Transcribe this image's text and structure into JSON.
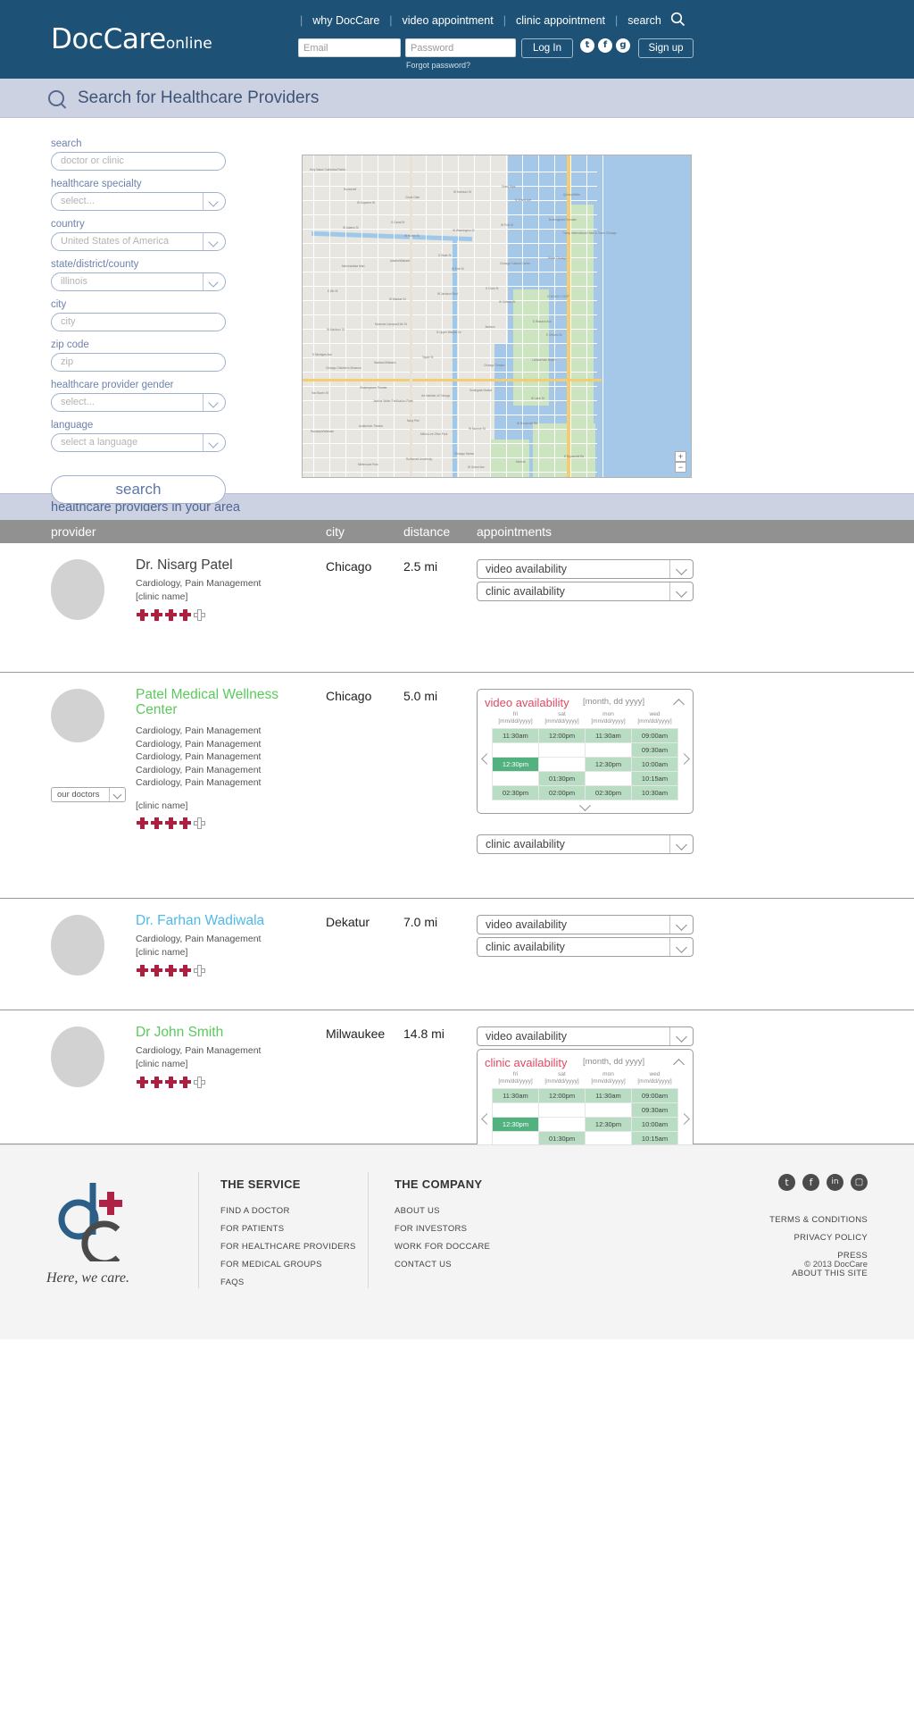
{
  "header": {
    "logo_main": "DocCare",
    "logo_sub": "online",
    "nav": [
      {
        "label": "why DocCare"
      },
      {
        "label": "video appointment"
      },
      {
        "label": "clinic appointment"
      },
      {
        "label": "search"
      }
    ],
    "search_icon": "search-icon",
    "email_placeholder": "Email",
    "password_placeholder": "Password",
    "login_label": "Log In",
    "signup_label": "Sign up",
    "forgot_label": "Forgot password?",
    "socials": [
      "t",
      "f",
      "g"
    ],
    "bg_color": "#1d5175"
  },
  "banner": {
    "title": "Search for Healthcare Providers"
  },
  "search_form": {
    "fields": [
      {
        "label": "search",
        "placeholder": "doctor or clinic",
        "type": "text",
        "name": "search-input"
      },
      {
        "label": "healthcare specialty",
        "placeholder": "select...",
        "type": "select",
        "name": "specialty-select"
      },
      {
        "label": "country",
        "placeholder": "United States of America",
        "type": "select",
        "name": "country-select"
      },
      {
        "label": "state/district/county",
        "placeholder": "illinois",
        "type": "select",
        "name": "state-select"
      },
      {
        "label": "city",
        "placeholder": "city",
        "type": "text",
        "name": "city-input"
      },
      {
        "label": "zip code",
        "placeholder": "zip",
        "type": "text",
        "name": "zip-input"
      },
      {
        "label": "healthcare provider gender",
        "placeholder": "select...",
        "type": "select",
        "name": "gender-select"
      },
      {
        "label": "language",
        "placeholder": "select a language",
        "type": "select",
        "name": "language-select"
      }
    ],
    "submit_label": "search"
  },
  "map": {
    "zoom_in": "+",
    "zoom_out": "−",
    "labels": [
      "Holy Name Cathedral Parish",
      "W Superior St",
      "W Huron St",
      "W Erie St",
      "W Ontario St",
      "E Ontario St",
      "Chicago Children's Museum",
      "Jardine Water Purification Plant",
      "Milton Lee Olive Park",
      "W Grand Ave",
      "N Grand Ave",
      "Trump International Hotel & Tower Chicago",
      "Merchandise Mart",
      "W Wacker Dr",
      "N Upper Wacker Dr",
      "Chicago Theatre",
      "W Lake St",
      "Randolph/Wabash",
      "Millennium Park",
      "Cloud Gate",
      "W Washington St",
      "Chicago Cultural Center",
      "CHICAGO LOOP",
      "W Madison St",
      "Madison/Wabash",
      "Art Institute of Chicago",
      "W Monroe St",
      "Monroe",
      "Quincy/Wells",
      "W Adams St",
      "Adams/Wabash",
      "W Jackson Blvd",
      "Jackson",
      "LaSalle/Van Buren",
      "Van Buren St",
      "Auditorium Theatre",
      "Roosevelt University",
      "W Harrison St",
      "W Polk St",
      "Hilton Chicago",
      "E 8th St",
      "Museum Campus/11th St",
      "Taylor St",
      "Southgate Market",
      "W Roosevelt Rd",
      "E Roosevelt Rd",
      "Roosevelt",
      "S Canal St",
      "S State St",
      "S Clark St",
      "S Wabash Ave",
      "S Michigan Ave",
      "Shakespeare Theater",
      "Navy Pier",
      "Chicago Harbor",
      "Grant Park",
      "Buckingham Fountain"
    ]
  },
  "results": {
    "section_title": "healthcare providers in your area",
    "columns": [
      "provider",
      "city",
      "distance",
      "appointments"
    ],
    "rows": [
      {
        "name": "Dr. Nisarg Patel",
        "name_color": "#3f3f3f",
        "specialties": [
          "Cardiology, Pain Management"
        ],
        "clinic": "[clinic name]",
        "city": "Chicago",
        "distance": "2.5 mi",
        "rating_filled": 4,
        "rating_total": 5,
        "has_our_doctors": false,
        "appointments": [
          {
            "label": "video availability",
            "expanded": false
          },
          {
            "label": "clinic availability",
            "expanded": false
          }
        ]
      },
      {
        "name": "Patel Medical Wellness Center",
        "name_color": "#5cc95c",
        "specialties": [
          "Cardiology, Pain Management",
          "Cardiology, Pain Management",
          "Cardiology, Pain Management",
          "Cardiology, Pain Management",
          "Cardiology, Pain Management"
        ],
        "clinic": "[clinic name]",
        "city": "Chicago",
        "distance": "5.0 mi",
        "rating_filled": 4,
        "rating_total": 5,
        "has_our_doctors": true,
        "our_doctors_label": "our doctors",
        "appointments": [
          {
            "label": "video availability",
            "expanded": true
          },
          {
            "label": "clinic availability",
            "expanded": false
          }
        ]
      },
      {
        "name": "Dr. Farhan Wadiwala",
        "name_color": "#4fb9e8",
        "specialties": [
          "Cardiology, Pain Management"
        ],
        "clinic": "[clinic name]",
        "city": "Dekatur",
        "distance": "7.0 mi",
        "rating_filled": 4,
        "rating_total": 5,
        "has_our_doctors": false,
        "appointments": [
          {
            "label": "video availability",
            "expanded": false
          },
          {
            "label": "clinic availability",
            "expanded": false
          }
        ]
      },
      {
        "name": "Dr John Smith",
        "name_color": "#5cc95c",
        "specialties": [
          "Cardiology, Pain Management"
        ],
        "clinic": "[clinic name]",
        "city": "Milwaukee",
        "distance": "14.8 mi",
        "rating_filled": 4,
        "rating_total": 5,
        "has_our_doctors": false,
        "appointments": [
          {
            "label": "video availability",
            "expanded": false
          },
          {
            "label": "clinic availability",
            "expanded": true
          }
        ]
      }
    ]
  },
  "calendar": {
    "date_placeholder": "[month, dd yyyy]",
    "days": [
      {
        "dow": "fri",
        "date": "[mm/dd/yyyy]"
      },
      {
        "dow": "sat",
        "date": "[mm/dd/yyyy]"
      },
      {
        "dow": "mon",
        "date": "[mm/dd/yyyy]"
      },
      {
        "dow": "wed",
        "date": "[mm/dd/yyyy]"
      }
    ],
    "slots": [
      [
        "11:30am",
        "12:00pm",
        "11:30am",
        "09:00am"
      ],
      [
        "",
        "",
        "",
        "09:30am"
      ],
      [
        "12:30pm",
        "",
        "12:30pm",
        "10:00am"
      ],
      [
        "",
        "01:30pm",
        "",
        "10:15am"
      ],
      [
        "02:30pm",
        "02:00pm",
        "02:30pm",
        "10:30am"
      ]
    ],
    "selected": {
      "row": 2,
      "col": 0
    },
    "prev_icon": "chevron-left-icon",
    "next_icon": "chevron-right-icon",
    "collapse_icon": "chevron-up-icon",
    "expand_icon": "chevron-down-icon",
    "title_color": "#de4a63"
  },
  "footer": {
    "tagline": "Here, we care.",
    "columns": [
      {
        "heading": "THE SERVICE",
        "links": [
          "FIND A DOCTOR",
          "FOR PATIENTS",
          "FOR HEALTHCARE PROVIDERS",
          "FOR MEDICAL GROUPS",
          "FAQS"
        ]
      },
      {
        "heading": "THE COMPANY",
        "links": [
          "ABOUT US",
          "FOR INVESTORS",
          "WORK FOR DOCCARE",
          "CONTACT US"
        ]
      }
    ],
    "socials": [
      "t",
      "f",
      "in",
      "ig"
    ],
    "legal_links": [
      "TERMS & CONDITIONS",
      "PRIVACY POLICY",
      "PRESS",
      "ABOUT THIS SITE"
    ],
    "copyright": "© 2013 DocCare"
  }
}
